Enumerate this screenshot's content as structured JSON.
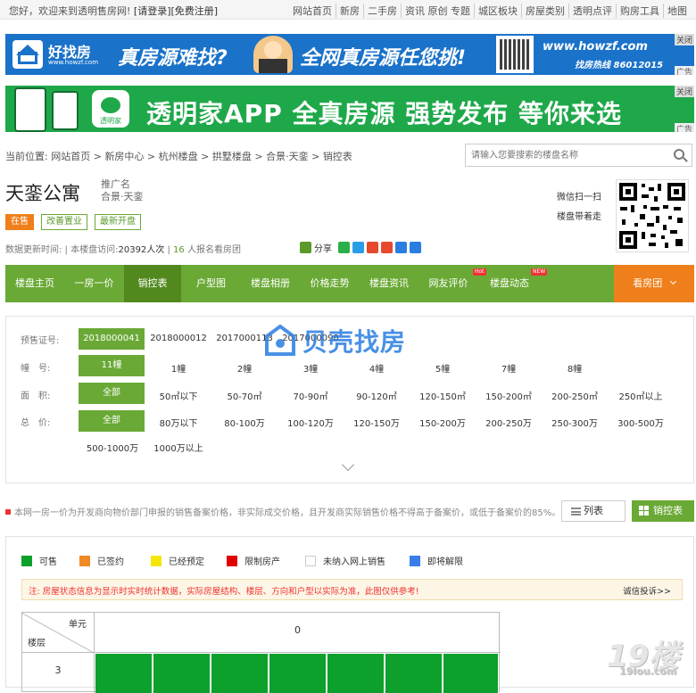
{
  "topbar": {
    "greeting": "您好，欢迎来到透明售房网!",
    "login": "[请登录]",
    "register": "[免费注册]",
    "links": [
      "网站首页",
      "新房",
      "二手房",
      "资讯 原创 专题",
      "城区板块",
      "房屋类别",
      "透明点评",
      "购房工具",
      "地图"
    ]
  },
  "banner1": {
    "brand": "好找房",
    "brand_url": "www.howzf.com",
    "slogan1": "真房源难找?",
    "slogan2": "全网真房源任您挑!",
    "site": "www.howzf.com",
    "hotline": "找房热线 86012015",
    "close": "关闭",
    "ad": "广告"
  },
  "banner2": {
    "app_name": "透明家",
    "slogan": "透明家APP 全真房源 强势发布 等你来选",
    "close": "关闭",
    "ad": "广告"
  },
  "breadcrumb": {
    "prefix": "当前位置:",
    "items": [
      "网站首页",
      "新房中心",
      "杭州楼盘",
      "拱墅楼盘",
      "合景·天銮",
      "销控表"
    ]
  },
  "search": {
    "placeholder": "请输入您要搜索的楼盘名称"
  },
  "property": {
    "title": "天銮公寓",
    "promo_label": "推广名",
    "promo_name": "合景·天銮",
    "tags": [
      "在售",
      "改善置业",
      "最新开盘"
    ],
    "meta_update": "数据更新时间:",
    "meta_visits_label": "本楼盘访问:",
    "meta_visits": "20392人次",
    "meta_signup_num": "16",
    "meta_signup": "人报名看房团",
    "share_label": "分享",
    "wechat1": "微信扫一扫",
    "wechat2": "楼盘带着走"
  },
  "nav": {
    "items": [
      "楼盘主页",
      "一房一价",
      "销控表",
      "户型图",
      "楼盘相册",
      "价格走势",
      "楼盘资讯",
      "网友评价",
      "楼盘动态"
    ],
    "active": "销控表",
    "badge_hot": "Hot",
    "badge_new": "NEW",
    "tour": "看房团"
  },
  "filters": {
    "presale_label": "预售证号:",
    "presale": [
      "2018000041",
      "2018000012",
      "2017000113",
      "2017000098"
    ],
    "building_label": "幢　号:",
    "buildings": [
      "11幢",
      "1幢",
      "2幢",
      "3幢",
      "4幢",
      "5幢",
      "7幢",
      "8幢"
    ],
    "area_label": "面　积:",
    "areas": [
      "全部",
      "50㎡以下",
      "50-70㎡",
      "70-90㎡",
      "90-120㎡",
      "120-150㎡",
      "150-200㎡",
      "200-250㎡",
      "250㎡以上"
    ],
    "price_label": "总　价:",
    "prices": [
      "全部",
      "80万以下",
      "80-100万",
      "100-120万",
      "120-150万",
      "150-200万",
      "200-250万",
      "250-300万",
      "300-500万",
      "500-1000万",
      "1000万以上"
    ]
  },
  "watermark": "贝壳找房",
  "notice": {
    "text": "本网一房一价为开发商向物价部门申报的销售备案价格，非实际成交价格，且开发商实际销售价格不得高于备案价，或低于备案价的85%。",
    "btn_list": "列表",
    "btn_table": "销控表"
  },
  "legend": [
    {
      "label": "可售",
      "color": "#0ea02c"
    },
    {
      "label": "已签约",
      "color": "#f08a24"
    },
    {
      "label": "已经预定",
      "color": "#f5e60a"
    },
    {
      "label": "限制房产",
      "color": "#e00000"
    },
    {
      "label": "未纳入网上销售",
      "color": "#ffffff"
    },
    {
      "label": "即将解限",
      "color": "#3a7de8"
    }
  ],
  "warning": {
    "text": "注: 房屋状态信息为显示时实时统计数据，实际房屋结构、楼层、方向和户型以实际为准，此图仅供参考!",
    "link": "诚信投诉>>"
  },
  "grid": {
    "unit_label": "单元",
    "floor_label": "楼层",
    "unit": "0",
    "floor": "3"
  },
  "corner_logo": {
    "main": "19楼",
    "sub": "19lou.com"
  }
}
